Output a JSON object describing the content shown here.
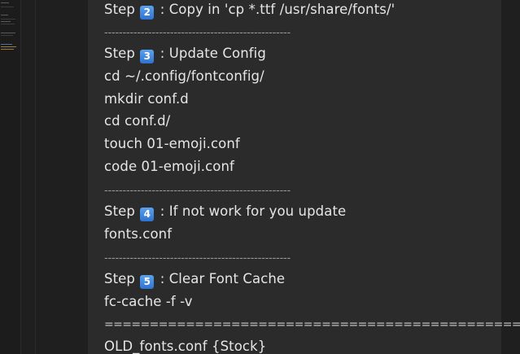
{
  "doc": {
    "step2": {
      "prefix": "Step",
      "num": "2",
      "text": ": Copy in 'cp *.ttf /usr/share/fonts/'"
    },
    "sep1": "---------------------------------------------------",
    "step3": {
      "prefix": "Step",
      "num": "3",
      "text": ": Update Config"
    },
    "cmd1": "cd ~/.config/fontconfig/",
    "cmd2": "mkdir conf.d",
    "cmd3": "cd conf.d/",
    "cmd4": "touch 01-emoji.conf",
    "cmd5": "code 01-emoji.conf",
    "sep2": "---------------------------------------------------",
    "step4": {
      "prefix": "Step",
      "num": "4",
      "text": ": If not work for you update"
    },
    "cmd6": "fonts.conf",
    "sep3": "---------------------------------------------------",
    "step5": {
      "prefix": "Step",
      "num": "5",
      "text": ": Clear Font Cache"
    },
    "cmd7": "fc-cache -f -v",
    "sep4": "====================================================",
    "old": "OLD_fonts.conf {Stock}"
  },
  "colors": {
    "background": "#1f1f1f",
    "panel": "#2b2b2b",
    "text": "#e6e6e6",
    "badge": "#3a82dd"
  }
}
